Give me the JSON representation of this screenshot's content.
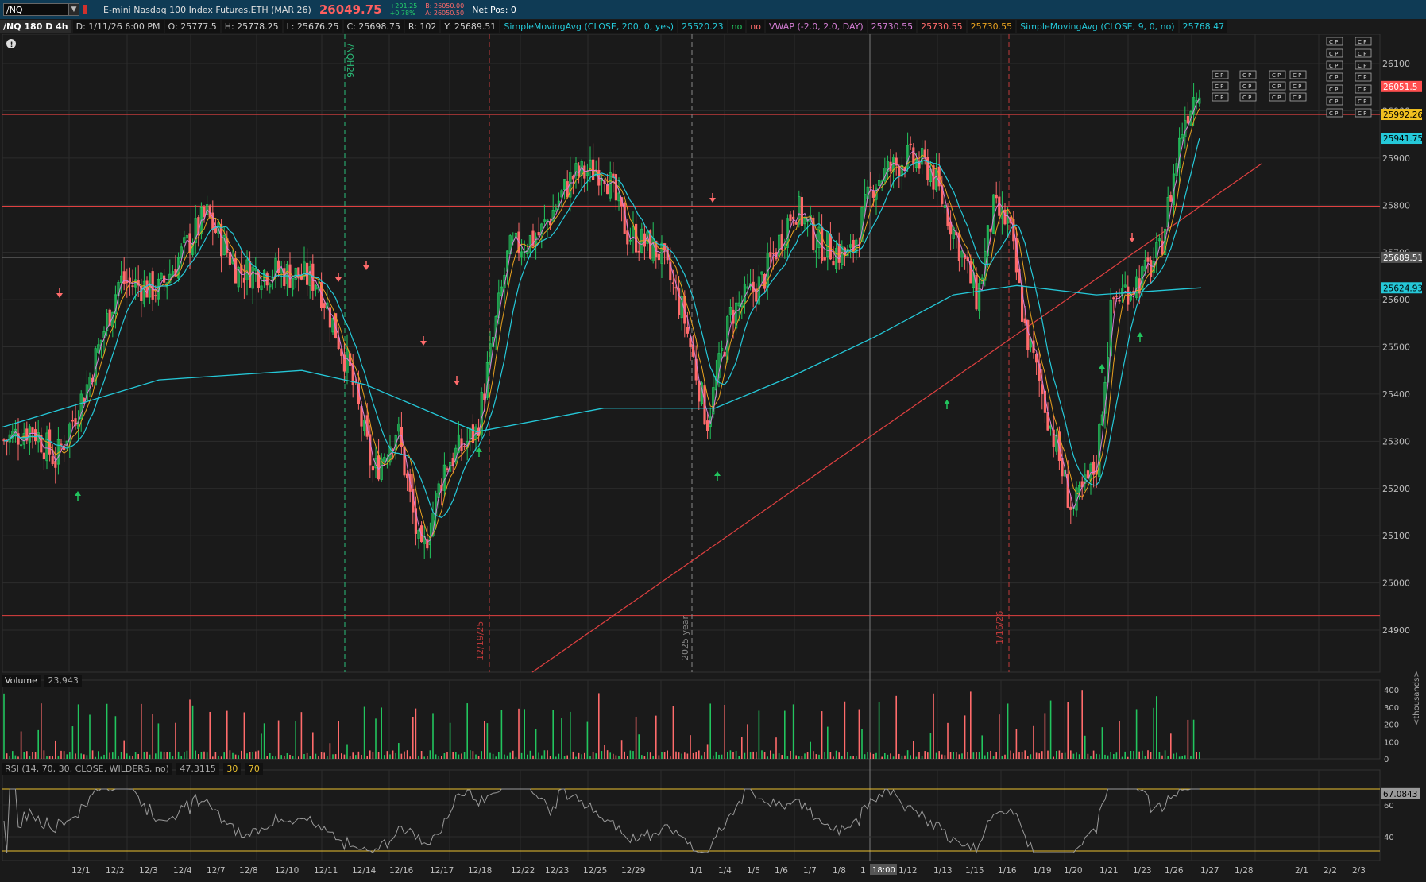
{
  "header": {
    "symbol": "/NQ",
    "instrument": "E-mini Nasdaq 100 Index Futures,ETH (MAR 26)",
    "last_price": "26049.75",
    "change": "+201.25",
    "change_pct": "+0.78%",
    "bid": "B: 26050.00",
    "ask": "A: 26050.50",
    "net_pos": "Net Pos: 0"
  },
  "studies": {
    "chart_id": "/NQ 180 D 4h",
    "date": "D: 1/11/26 6:00 PM",
    "open": "O: 25777.5",
    "high": "H: 25778.25",
    "low": "L: 25676.25",
    "close": "C: 25698.75",
    "range": "R: 102",
    "y": "Y: 25689.51",
    "sma200_label": "SimpleMovingAvg (CLOSE, 200, 0, yes)",
    "sma200_value": "25520.23",
    "no1": "no",
    "no2": "no",
    "vwap_label": "VWAP (-2.0, 2.0, DAY)",
    "vwap_v1": "25730.55",
    "vwap_v2": "25730.55",
    "vwap_v3": "25730.55",
    "sma9_label": "SimpleMovingAvg (CLOSE, 9, 0, no)",
    "sma9_value": "25768.47"
  },
  "price_axis": {
    "ticks": [
      "26100",
      "26000",
      "25900",
      "25800",
      "25700",
      "25600",
      "25500",
      "25400",
      "25300",
      "25200",
      "25100",
      "25000",
      "24900"
    ],
    "bubbles": [
      {
        "text": "26051.5",
        "color": "#ff4f4f",
        "text_color": "#ffffff"
      },
      {
        "text": "25992.26",
        "color": "#f0c020",
        "text_color": "#000000"
      },
      {
        "text": "25941.75",
        "color": "#25c8d8",
        "text_color": "#000000"
      },
      {
        "text": "25689.51",
        "color": "#555555",
        "text_color": "#ffffff"
      },
      {
        "text": "25624.93",
        "color": "#25c8d8",
        "text_color": "#000000"
      }
    ]
  },
  "markers": {
    "nqh26": "/NQH26",
    "m1": "12/19/25",
    "year": "2025 year",
    "m2": "1/16/26"
  },
  "x_axis": {
    "labels": [
      "12/1",
      "12/2",
      "12/3",
      "12/4",
      "12/7",
      "12/8",
      "12/10",
      "12/11",
      "12/14",
      "12/16",
      "12/17",
      "12/18",
      "12/22",
      "12/23",
      "12/25",
      "12/29",
      "1/1",
      "1/4",
      "1/5",
      "1/6",
      "1/7",
      "1/8",
      "1",
      "1/12",
      "1/13",
      "1/15",
      "1/16",
      "1/19",
      "1/20",
      "1/21",
      "1/23",
      "1/26",
      "1/27",
      "1/28",
      "2/1",
      "2/2",
      "2/3"
    ],
    "crosshair_time": "18:00"
  },
  "volume_pane": {
    "label": "Volume",
    "value": "23,943",
    "ticks": [
      "400",
      "300",
      "200",
      "100",
      "0"
    ],
    "unit": "<thousands>"
  },
  "rsi_pane": {
    "label": "RSI (14, 70, 30, CLOSE, WILDERS, no)",
    "value": "47.3115",
    "low": "30",
    "high": "70",
    "ticks": [
      "60",
      "40"
    ],
    "bubble": "67.0843"
  },
  "colors": {
    "up": "#22c55e",
    "down": "#ff6b6b",
    "sma200": "#25c8d8",
    "vwap": "#d77fd7",
    "sma9": "#e9a21f",
    "level": "#e04040"
  },
  "cp_label": "C P"
}
